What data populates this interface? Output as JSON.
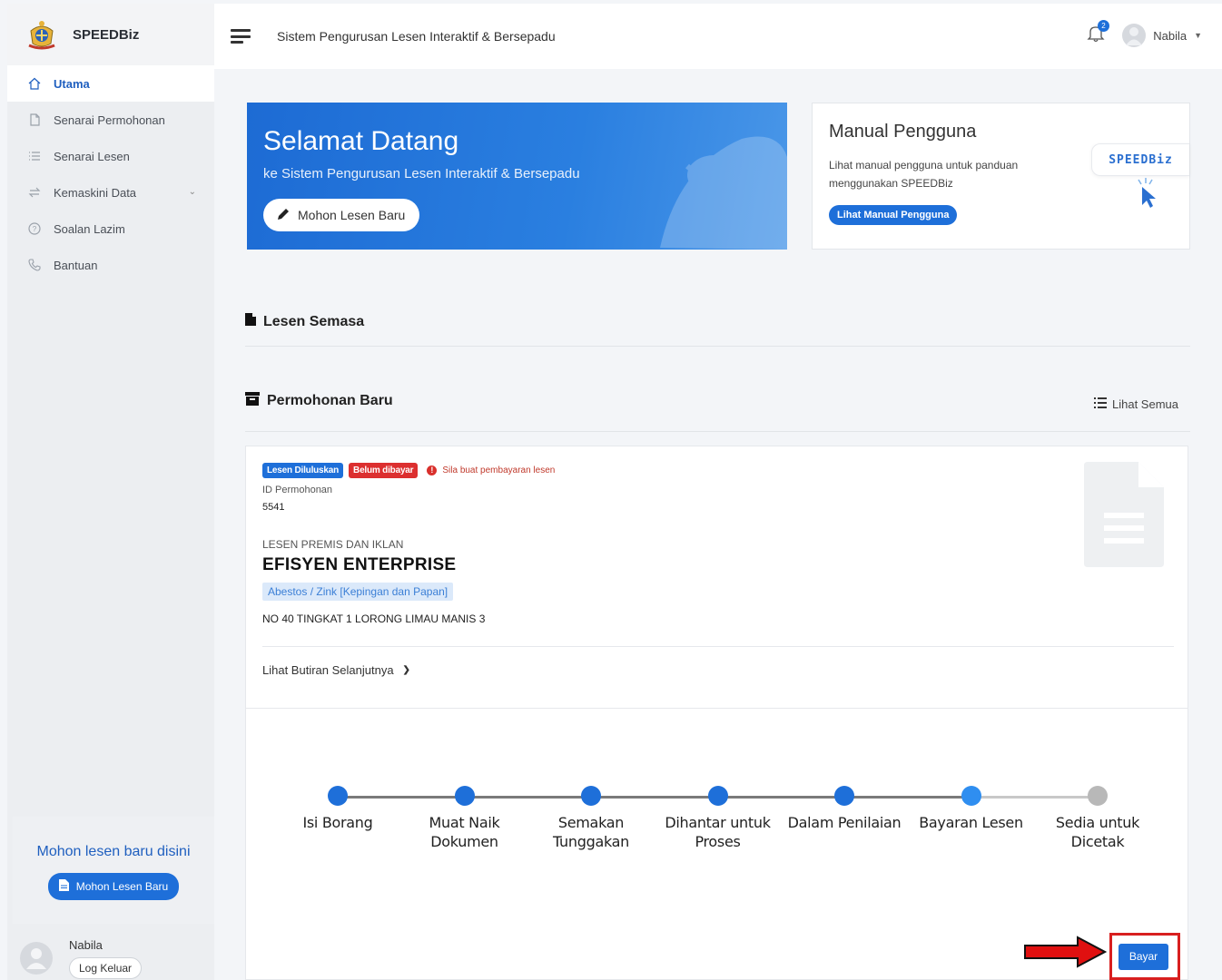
{
  "brand": {
    "name": "SPEEDBiz"
  },
  "sidebar": {
    "items": [
      {
        "label": "Utama",
        "icon": "home-icon",
        "active": true
      },
      {
        "label": "Senarai Permohonan",
        "icon": "file-icon"
      },
      {
        "label": "Senarai Lesen",
        "icon": "list-icon"
      },
      {
        "label": "Kemaskini Data",
        "icon": "sync-icon",
        "has_submenu": true
      },
      {
        "label": "Soalan Lazim",
        "icon": "question-icon"
      },
      {
        "label": "Bantuan",
        "icon": "phone-icon"
      }
    ],
    "promo_title": "Mohon lesen baru disini",
    "promo_button": "Mohon Lesen Baru",
    "user_name": "Nabila",
    "logout_label": "Log Keluar"
  },
  "header": {
    "title": "Sistem Pengurusan Lesen Interaktif & Bersepadu",
    "notification_count": "2",
    "user_name": "Nabila"
  },
  "welcome": {
    "title": "Selamat Datang",
    "subtitle": "ke Sistem Pengurusan Lesen Interaktif & Bersepadu",
    "button": "Mohon Lesen Baru"
  },
  "manual": {
    "title": "Manual Pengguna",
    "description": "Lihat manual pengguna untuk panduan menggunakan SPEEDBiz",
    "button": "Lihat Manual Pengguna",
    "logo_text": "SPEEDBiz"
  },
  "sections": {
    "current": "Lesen Semasa",
    "new_applications": "Permohonan Baru",
    "view_all": "Lihat Semua"
  },
  "application": {
    "status_badge": "Lesen Diluluskan",
    "payment_badge": "Belum dibayar",
    "warning": "Sila buat pembayaran lesen",
    "id_label": "ID Permohonan",
    "id_value": "5541",
    "license_type": "LESEN PREMIS DAN IKLAN",
    "company": "EFISYEN ENTERPRISE",
    "category": "Abestos / Zink [Kepingan dan Papan]",
    "address": "NO 40 TINGKAT 1 LORONG LIMAU MANIS 3",
    "more_label": "Lihat Butiran Selanjutnya",
    "pay_button": "Bayar"
  },
  "stepper": {
    "steps": [
      {
        "line1": "Isi Borang",
        "line2": "",
        "state": "done"
      },
      {
        "line1": "Muat Naik",
        "line2": "Dokumen",
        "state": "done"
      },
      {
        "line1": "Semakan",
        "line2": "Tunggakan",
        "state": "done"
      },
      {
        "line1": "Dihantar untuk",
        "line2": "Proses",
        "state": "done"
      },
      {
        "line1": "Dalam Penilaian",
        "line2": "",
        "state": "done"
      },
      {
        "line1": "Bayaran Lesen",
        "line2": "",
        "state": "current"
      },
      {
        "line1": "Sedia untuk",
        "line2": "Dicetak",
        "state": "pending"
      }
    ]
  },
  "colors": {
    "primary": "#1e6fd9",
    "current_step": "#2f8ef0",
    "pending_step": "#b8b8b8",
    "danger": "#dc2f2f",
    "highlight": "#d81f1f"
  }
}
